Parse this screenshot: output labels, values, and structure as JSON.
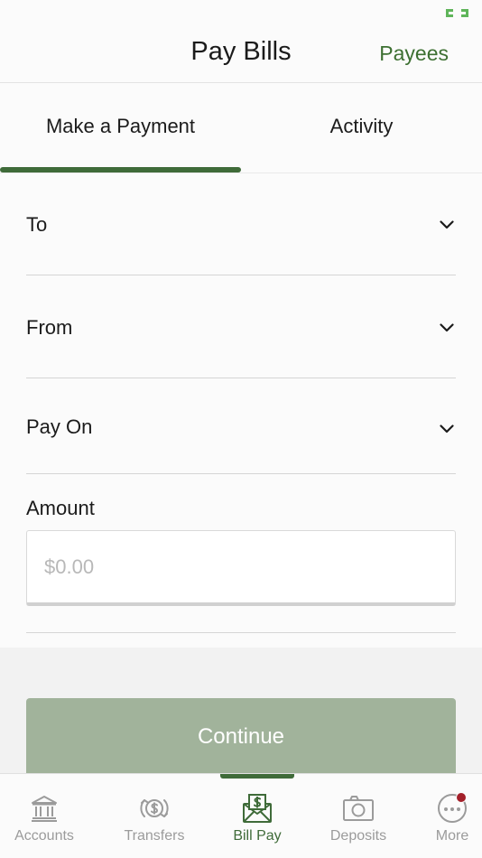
{
  "header": {
    "title": "Pay Bills",
    "payees_label": "Payees"
  },
  "tabs": [
    {
      "label": "Make a Payment",
      "active": true
    },
    {
      "label": "Activity",
      "active": false
    }
  ],
  "form": {
    "to_label": "To",
    "from_label": "From",
    "pay_on_label": "Pay On",
    "amount_label": "Amount",
    "amount_placeholder": "$0.00",
    "amount_value": ""
  },
  "continue_label": "Continue",
  "bottom_nav": [
    {
      "label": "Accounts",
      "icon": "bank-icon",
      "active": false
    },
    {
      "label": "Transfers",
      "icon": "transfer-icon",
      "active": false
    },
    {
      "label": "Bill Pay",
      "icon": "bill-pay-icon",
      "active": true
    },
    {
      "label": "Deposits",
      "icon": "camera-icon",
      "active": false
    },
    {
      "label": "More",
      "icon": "more-icon",
      "active": false,
      "badge": true
    }
  ],
  "colors": {
    "brand_green": "#3f6b39",
    "link_green": "#3d7032",
    "button_disabled": "#a1b39b",
    "badge_red": "#a3202a",
    "inactive_gray": "#9b9b9b"
  }
}
